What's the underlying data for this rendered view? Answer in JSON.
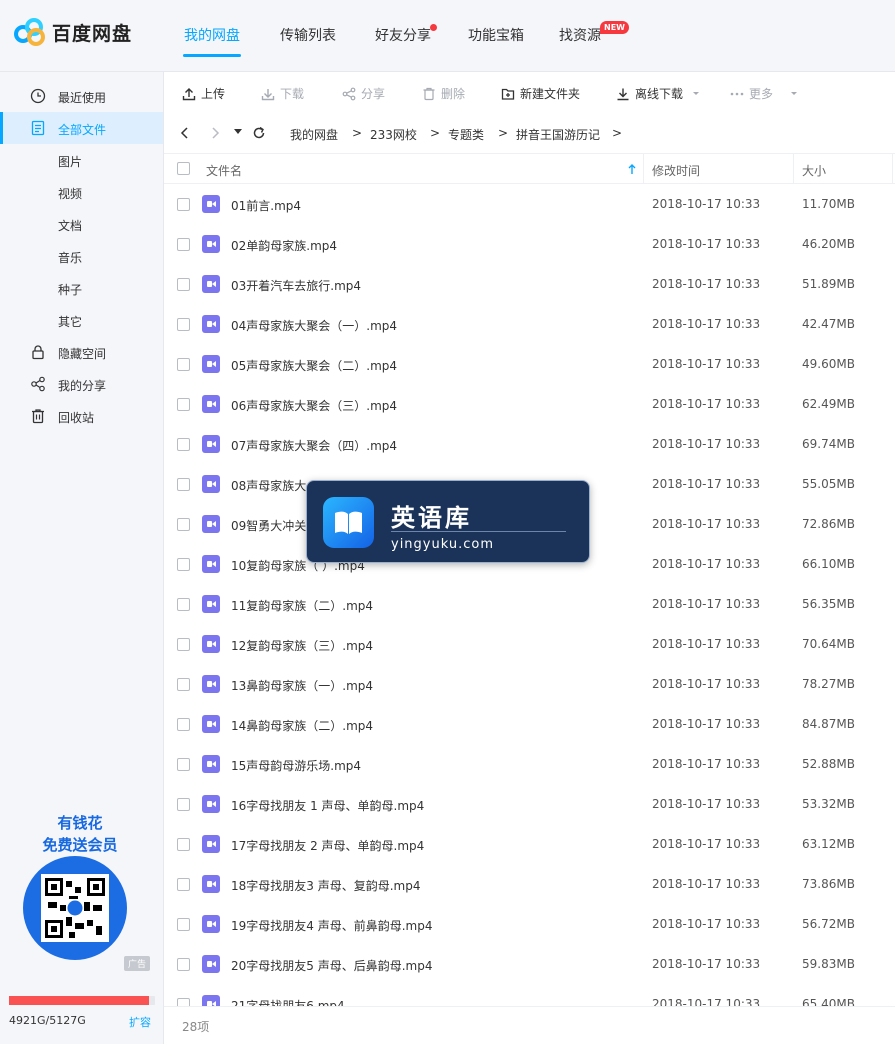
{
  "app": {
    "name": "百度网盘"
  },
  "nav": [
    {
      "label": "我的网盘",
      "active": true
    },
    {
      "label": "传输列表"
    },
    {
      "label": "好友分享",
      "dot": true
    },
    {
      "label": "功能宝箱"
    },
    {
      "label": "找资源",
      "badge": "NEW"
    }
  ],
  "sidebar": {
    "items": [
      {
        "label": "最近使用",
        "icon": "clock-icon"
      },
      {
        "label": "全部文件",
        "icon": "file-icon",
        "active": true
      },
      {
        "label": "图片"
      },
      {
        "label": "视频"
      },
      {
        "label": "文档"
      },
      {
        "label": "音乐"
      },
      {
        "label": "种子"
      },
      {
        "label": "其它"
      },
      {
        "label": "隐藏空间",
        "icon": "lock-icon"
      },
      {
        "label": "我的分享",
        "icon": "share-icon"
      },
      {
        "label": "回收站",
        "icon": "trash-icon"
      }
    ],
    "promo": {
      "line1": "有钱花",
      "line2": "免费送会员",
      "ad": "广告"
    },
    "storage": {
      "text": "4921G/5127G",
      "expand": "扩容",
      "used_fraction": 0.96
    }
  },
  "toolbar": {
    "upload": "上传",
    "download": "下载",
    "share": "分享",
    "delete": "删除",
    "new_folder": "新建文件夹",
    "offline": "离线下载",
    "more": "更多"
  },
  "breadcrumb": [
    "我的网盘",
    "233网校",
    "专题类",
    "拼音王国游历记"
  ],
  "table": {
    "headers": {
      "name": "文件名",
      "modified": "修改时间",
      "size": "大小"
    },
    "rows": [
      {
        "name": "01前言.mp4",
        "time": "2018-10-17 10:33",
        "size": "11.70MB"
      },
      {
        "name": "02单韵母家族.mp4",
        "time": "2018-10-17 10:33",
        "size": "46.20MB"
      },
      {
        "name": "03开着汽车去旅行.mp4",
        "time": "2018-10-17 10:33",
        "size": "51.89MB"
      },
      {
        "name": "04声母家族大聚会（一）.mp4",
        "time": "2018-10-17 10:33",
        "size": "42.47MB"
      },
      {
        "name": "05声母家族大聚会（二）.mp4",
        "time": "2018-10-17 10:33",
        "size": "49.60MB"
      },
      {
        "name": "06声母家族大聚会（三）.mp4",
        "time": "2018-10-17 10:33",
        "size": "62.49MB"
      },
      {
        "name": "07声母家族大聚会（四）.mp4",
        "time": "2018-10-17 10:33",
        "size": "69.74MB"
      },
      {
        "name": "08声母家族大",
        "time": "2018-10-17 10:33",
        "size": "55.05MB"
      },
      {
        "name": "09智勇大冲关",
        "time": "2018-10-17 10:33",
        "size": "72.86MB"
      },
      {
        "name": "10复韵母家族（ ）.mp4",
        "time": "2018-10-17 10:33",
        "size": "66.10MB"
      },
      {
        "name": "11复韵母家族（二）.mp4",
        "time": "2018-10-17 10:33",
        "size": "56.35MB"
      },
      {
        "name": "12复韵母家族（三）.mp4",
        "time": "2018-10-17 10:33",
        "size": "70.64MB"
      },
      {
        "name": "13鼻韵母家族（一）.mp4",
        "time": "2018-10-17 10:33",
        "size": "78.27MB"
      },
      {
        "name": "14鼻韵母家族（二）.mp4",
        "time": "2018-10-17 10:33",
        "size": "84.87MB"
      },
      {
        "name": "15声母韵母游乐场.mp4",
        "time": "2018-10-17 10:33",
        "size": "52.88MB"
      },
      {
        "name": "16字母找朋友 1 声母、单韵母.mp4",
        "time": "2018-10-17 10:33",
        "size": "53.32MB"
      },
      {
        "name": "17字母找朋友 2 声母、单韵母.mp4",
        "time": "2018-10-17 10:33",
        "size": "63.12MB"
      },
      {
        "name": "18字母找朋友3 声母、复韵母.mp4",
        "time": "2018-10-17 10:33",
        "size": "73.86MB"
      },
      {
        "name": "19字母找朋友4 声母、前鼻韵母.mp4",
        "time": "2018-10-17 10:33",
        "size": "56.72MB"
      },
      {
        "name": "20字母找朋友5 声母、后鼻韵母.mp4",
        "time": "2018-10-17 10:33",
        "size": "59.83MB"
      },
      {
        "name": "21字母找朋友6.mp4",
        "time": "2018-10-17 10:33",
        "size": "65.40MB"
      }
    ]
  },
  "footer": {
    "count": "28项"
  },
  "watermark": {
    "cn": "英语库",
    "en": "yingyuku.com"
  },
  "colors": {
    "accent": "#06a7ff",
    "storage": "#fa5252",
    "video_icon": "#7b76f0"
  }
}
